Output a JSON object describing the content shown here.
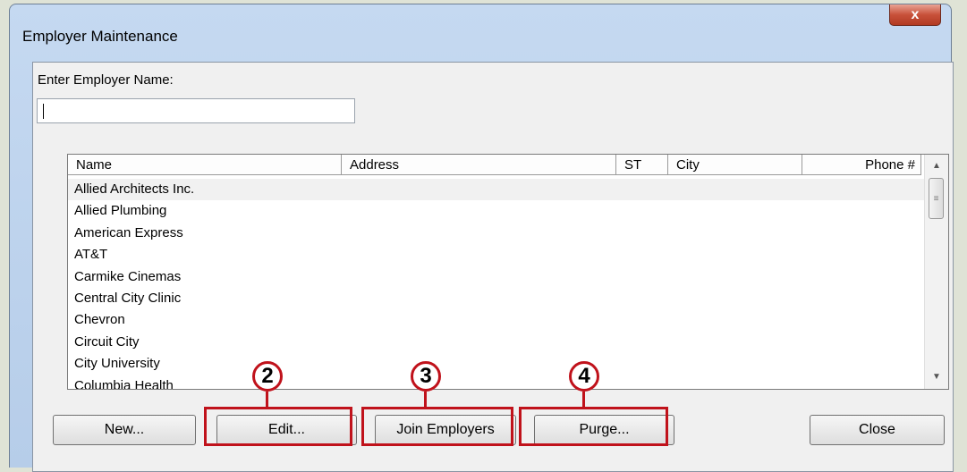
{
  "window": {
    "title": "Employer Maintenance",
    "close_glyph": "x"
  },
  "form": {
    "name_label": "Enter Employer  Name:",
    "name_value": ""
  },
  "list": {
    "columns": [
      "Name",
      "Address",
      "ST",
      "City",
      "Phone #"
    ],
    "rows": [
      "Allied Architects Inc.",
      "Allied Plumbing",
      "American Express",
      "AT&T",
      "Carmike Cinemas",
      "Central City Clinic",
      "Chevron",
      "Circuit City",
      "City University",
      "Columbia Health"
    ]
  },
  "buttons": {
    "new": "New...",
    "edit": "Edit...",
    "join": "Join Employers",
    "purge": "Purge...",
    "close": "Close"
  },
  "callouts": [
    "2",
    "3",
    "4"
  ],
  "colors": {
    "highlight": "#c0121b",
    "selected_row": "#f1f1f1"
  }
}
